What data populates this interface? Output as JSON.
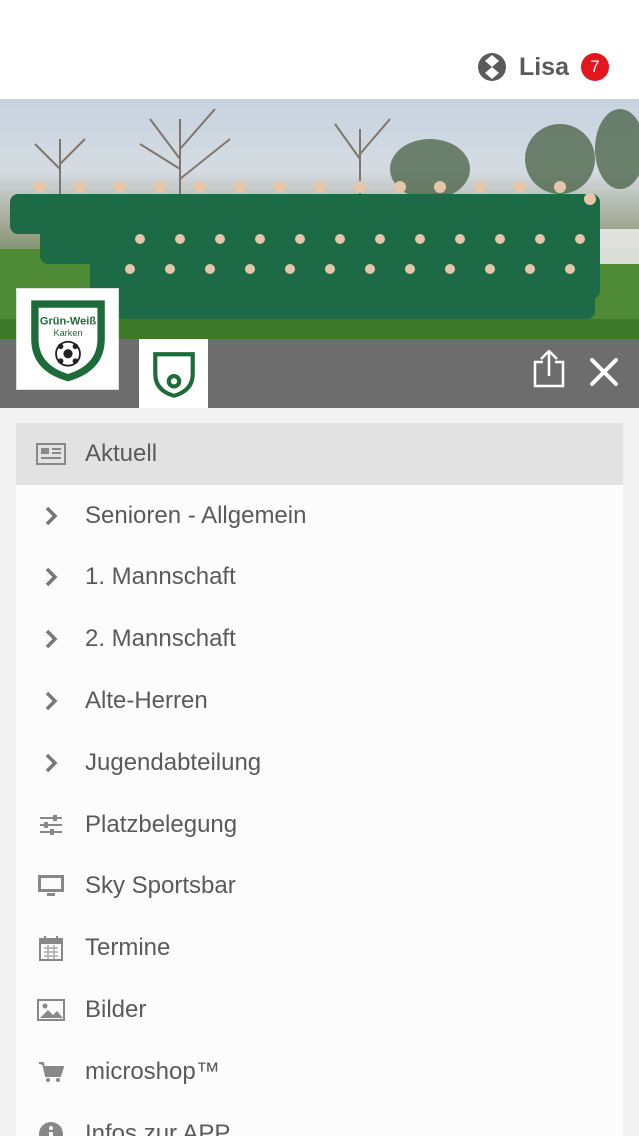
{
  "user": {
    "name": "Lisa",
    "notifications": "7"
  },
  "club": {
    "crest_top_text": "Grün-Weiß",
    "crest_bottom_text": "Karken"
  },
  "icons": {
    "user_logo": "app-logo-icon",
    "share": "share-icon",
    "close": "close-icon"
  },
  "menu": {
    "items": [
      {
        "label": "Aktuell",
        "icon": "newspaper-icon",
        "active": true
      },
      {
        "label": "Senioren - Allgemein",
        "icon": "chevron-right-icon"
      },
      {
        "label": "1. Mannschaft",
        "icon": "chevron-right-icon"
      },
      {
        "label": "2. Mannschaft",
        "icon": "chevron-right-icon"
      },
      {
        "label": "Alte-Herren",
        "icon": "chevron-right-icon"
      },
      {
        "label": "Jugendabteilung",
        "icon": "chevron-right-icon"
      },
      {
        "label": "Platzbelegung",
        "icon": "sliders-icon"
      },
      {
        "label": "Sky Sportsbar",
        "icon": "monitor-icon"
      },
      {
        "label": "Termine",
        "icon": "calendar-icon"
      },
      {
        "label": "Bilder",
        "icon": "image-icon"
      },
      {
        "label": "microshop™",
        "icon": "cart-icon"
      },
      {
        "label": "Infos zur APP",
        "icon": "info-icon"
      }
    ]
  },
  "colors": {
    "accent_red": "#e3161d",
    "club_green": "#1e6b3a",
    "bar_gray": "#6d6d6d",
    "active_row": "#e2e2e2"
  }
}
